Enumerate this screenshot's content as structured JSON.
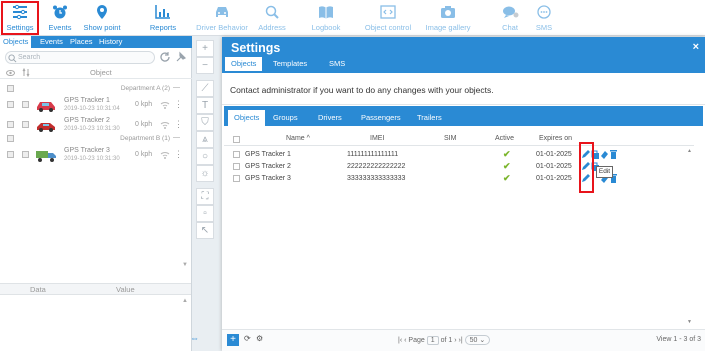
{
  "toolbar": {
    "items": [
      {
        "label": "Settings",
        "icon": "settings-icon"
      },
      {
        "label": "Events",
        "icon": "alarm-icon"
      },
      {
        "label": "Show point",
        "icon": "map-pin-icon"
      },
      {
        "label": "Reports",
        "icon": "chart-icon"
      },
      {
        "label": "Driver Behavior",
        "icon": "car-icon"
      },
      {
        "label": "Address",
        "icon": "search-icon"
      },
      {
        "label": "Logbook",
        "icon": "book-icon"
      },
      {
        "label": "Object control",
        "icon": "code-icon"
      },
      {
        "label": "Image gallery",
        "icon": "camera-icon"
      },
      {
        "label": "Chat",
        "icon": "chat-icon"
      },
      {
        "label": "SMS",
        "icon": "sms-icon"
      }
    ]
  },
  "left_panel": {
    "tabs": [
      "Objects",
      "Events",
      "Places",
      "History"
    ],
    "search_placeholder": "Search",
    "object_header": "Object",
    "groups": [
      {
        "name": "Department A (2)"
      },
      {
        "name": "Department B (1)"
      }
    ],
    "devices": [
      {
        "name": "GPS Tracker 1",
        "time": "2019-10-23 10:31:04",
        "speed": "0 kph"
      },
      {
        "name": "GPS Tracker 2",
        "time": "2019-10-23 10:31:30",
        "speed": "0 kph"
      },
      {
        "name": "GPS Tracker 3",
        "time": "2019-10-23 10:31:30",
        "speed": "0 kph"
      }
    ],
    "data_header": {
      "data": "Data",
      "value": "Value"
    }
  },
  "dialog": {
    "title": "Settings",
    "close": "×",
    "tabs": [
      "Objects",
      "Templates",
      "SMS"
    ],
    "notice": "Contact administrator if you want to do any changes with your objects.",
    "sub_tabs": [
      "Objects",
      "Groups",
      "Drivers",
      "Passengers",
      "Trailers"
    ],
    "columns": {
      "name": "Name ^",
      "imei": "IMEI",
      "sim": "SIM",
      "active": "Active",
      "expires": "Expires on"
    },
    "rows": [
      {
        "name": "GPS Tracker 1",
        "imei": "111111111111111",
        "sim": "",
        "active": "✔",
        "expires": "01-01-2025"
      },
      {
        "name": "GPS Tracker 2",
        "imei": "222222222222222",
        "sim": "",
        "active": "✔",
        "expires": "01-01-2025"
      },
      {
        "name": "GPS Tracker 3",
        "imei": "333333333333333",
        "sim": "",
        "active": "✔",
        "expires": "01-01-2025"
      }
    ],
    "tooltip": "Edit",
    "footer": {
      "add": "+",
      "page_label": "Page",
      "page_value": "1",
      "of_label": "of 1",
      "per_page": "50",
      "view": "View 1 - 3 of 3"
    }
  },
  "colors": {
    "accent": "#2a8ad4",
    "highlight": "#e8141b",
    "active_check": "#7bb52b"
  }
}
